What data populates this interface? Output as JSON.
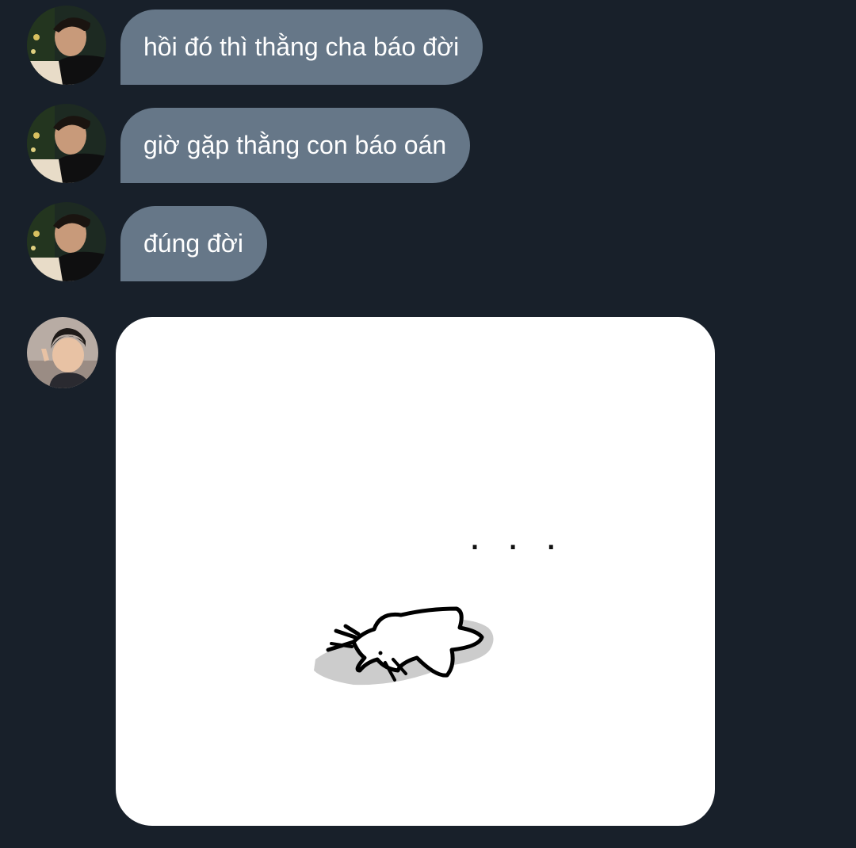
{
  "messages": [
    {
      "sender": "other-user-1",
      "text": "hồi đó thì thằng cha báo đời"
    },
    {
      "sender": "other-user-1",
      "text": "giờ gặp thằng con báo oán"
    },
    {
      "sender": "other-user-1",
      "text": "đúng đời"
    },
    {
      "sender": "other-user-2",
      "type": "sticker",
      "sticker_icon": "fallen-cat-drawing"
    }
  ],
  "sticker": {
    "ellipsis": ". . ."
  },
  "colors": {
    "background": "#18202a",
    "bubble": "#667788",
    "bubble_text": "#ffffff",
    "sticker_card": "#ffffff"
  }
}
